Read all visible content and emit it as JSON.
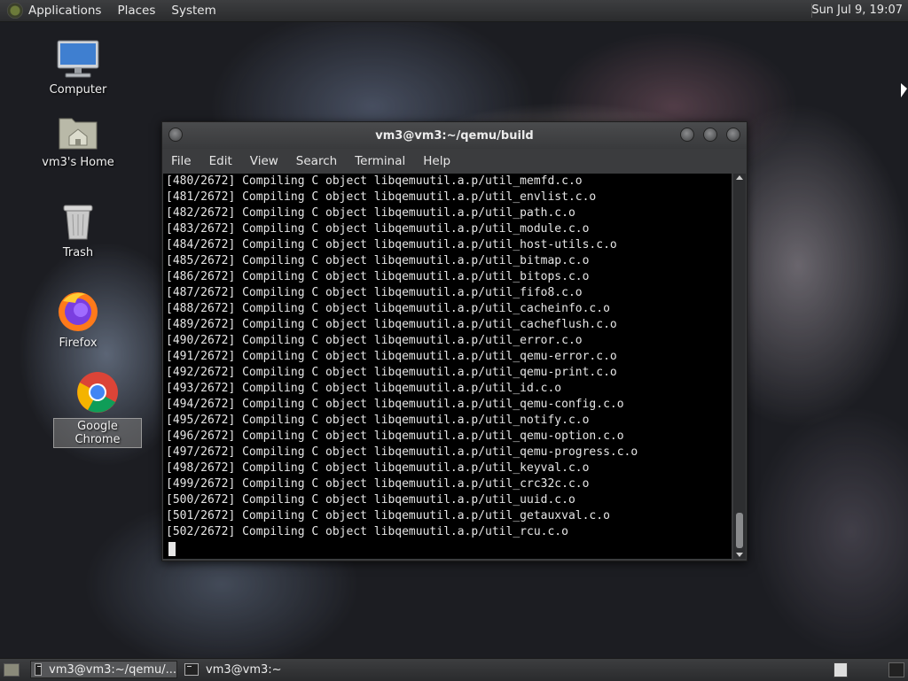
{
  "top_panel": {
    "menus": [
      "Applications",
      "Places",
      "System"
    ],
    "clock": "Sun Jul  9, 19:07"
  },
  "desktop_icons": [
    {
      "label": "Computer",
      "icon": "computer-icon"
    },
    {
      "label": "vm3's Home",
      "icon": "home-folder-icon"
    },
    {
      "label": "Trash",
      "icon": "trash-icon"
    },
    {
      "label": "Firefox",
      "icon": "firefox-icon"
    },
    {
      "label": "Google Chrome",
      "icon": "chrome-icon"
    }
  ],
  "terminal": {
    "title": "vm3@vm3:~/qemu/build",
    "menu": [
      "File",
      "Edit",
      "View",
      "Search",
      "Terminal",
      "Help"
    ],
    "lines": [
      "[480/2672] Compiling C object libqemuutil.a.p/util_memfd.c.o",
      "[481/2672] Compiling C object libqemuutil.a.p/util_envlist.c.o",
      "[482/2672] Compiling C object libqemuutil.a.p/util_path.c.o",
      "[483/2672] Compiling C object libqemuutil.a.p/util_module.c.o",
      "[484/2672] Compiling C object libqemuutil.a.p/util_host-utils.c.o",
      "[485/2672] Compiling C object libqemuutil.a.p/util_bitmap.c.o",
      "[486/2672] Compiling C object libqemuutil.a.p/util_bitops.c.o",
      "[487/2672] Compiling C object libqemuutil.a.p/util_fifo8.c.o",
      "[488/2672] Compiling C object libqemuutil.a.p/util_cacheinfo.c.o",
      "[489/2672] Compiling C object libqemuutil.a.p/util_cacheflush.c.o",
      "[490/2672] Compiling C object libqemuutil.a.p/util_error.c.o",
      "[491/2672] Compiling C object libqemuutil.a.p/util_qemu-error.c.o",
      "[492/2672] Compiling C object libqemuutil.a.p/util_qemu-print.c.o",
      "[493/2672] Compiling C object libqemuutil.a.p/util_id.c.o",
      "[494/2672] Compiling C object libqemuutil.a.p/util_qemu-config.c.o",
      "[495/2672] Compiling C object libqemuutil.a.p/util_notify.c.o",
      "[496/2672] Compiling C object libqemuutil.a.p/util_qemu-option.c.o",
      "[497/2672] Compiling C object libqemuutil.a.p/util_qemu-progress.c.o",
      "[498/2672] Compiling C object libqemuutil.a.p/util_keyval.c.o",
      "[499/2672] Compiling C object libqemuutil.a.p/util_crc32c.c.o",
      "[500/2672] Compiling C object libqemuutil.a.p/util_uuid.c.o",
      "[501/2672] Compiling C object libqemuutil.a.p/util_getauxval.c.o",
      "[502/2672] Compiling C object libqemuutil.a.p/util_rcu.c.o"
    ]
  },
  "taskbar": {
    "tasks": [
      "vm3@vm3:~/qemu/...",
      "vm3@vm3:~"
    ]
  }
}
